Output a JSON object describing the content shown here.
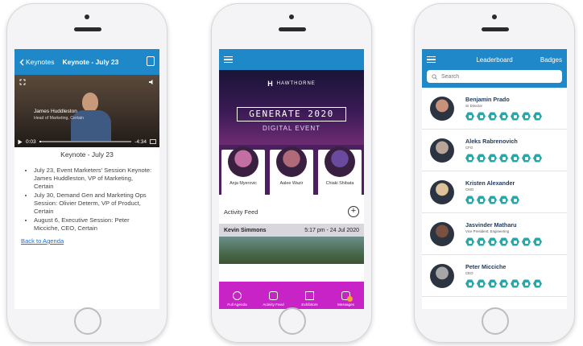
{
  "phone1": {
    "header": {
      "back_label": "Keynotes",
      "title": "Keynote - July 23"
    },
    "video": {
      "caption_name": "James Huddleston",
      "caption_role": "Head of Marketing, Certain",
      "time_current": "0:03",
      "time_remaining": "-4:34",
      "progress": 0.02
    },
    "subtitle": "Keynote - July 23",
    "bullets": [
      "July 23, Event Marketers' Session Keynote: James Huddleston, VP of Marketing, Certain",
      "July 30, Demand Gen and Marketing Ops Session: Olivier Determ, VP of Product, Certain",
      "August 6, Executive Session: Peter Micciche, CEO, Certain"
    ],
    "back_link": "Back to Agenda"
  },
  "phone2": {
    "brand": "HAWTHORNE",
    "event_title": "GENERATE 2020",
    "event_subtitle": "DIGITAL EVENT",
    "speakers": [
      {
        "name": "Anja Myerovic",
        "color": "#c46fa4"
      },
      {
        "name": "Aalee Wazir",
        "color": "#b06a7a"
      },
      {
        "name": "Chiaki Shibata",
        "color": "#6a4aa0"
      }
    ],
    "feed_title": "Activity Feed",
    "post": {
      "author": "Kevin Simmons",
      "timestamp": "5:17 pm - 24 Jul 2020"
    },
    "nav": [
      {
        "label": "Full Agenda",
        "icon": "agenda-icon"
      },
      {
        "label": "Activity Feed",
        "icon": "chat-icon"
      },
      {
        "label": "Exhibitors",
        "icon": "exhibitors-icon"
      },
      {
        "label": "Messages",
        "icon": "mail-icon"
      }
    ]
  },
  "phone3": {
    "header": {
      "title": "Leaderboard",
      "badges_label": "Badges"
    },
    "search_placeholder": "Search",
    "leaders": [
      {
        "name": "Benjamin Prado",
        "role": "Sr Director",
        "badge_count": 7,
        "avatar_color": "#c8927a"
      },
      {
        "name": "Aleks Rabrenovich",
        "role": "CFO",
        "badge_count": 7,
        "avatar_color": "#b8a59a"
      },
      {
        "name": "Kristen Alexander",
        "role": "CMO",
        "badge_count": 5,
        "avatar_color": "#e0c29a"
      },
      {
        "name": "Jasvinder Matharu",
        "role": "Vice President, Engineering",
        "badge_count": 7,
        "avatar_color": "#7a5040"
      },
      {
        "name": "Peter Micciche",
        "role": "CEO",
        "badge_count": 7,
        "avatar_color": "#a6a6a6"
      }
    ]
  },
  "colors": {
    "primary_blue": "#1f88c9",
    "magenta": "#c723c6",
    "badge_teal": "#2aa5a8"
  }
}
